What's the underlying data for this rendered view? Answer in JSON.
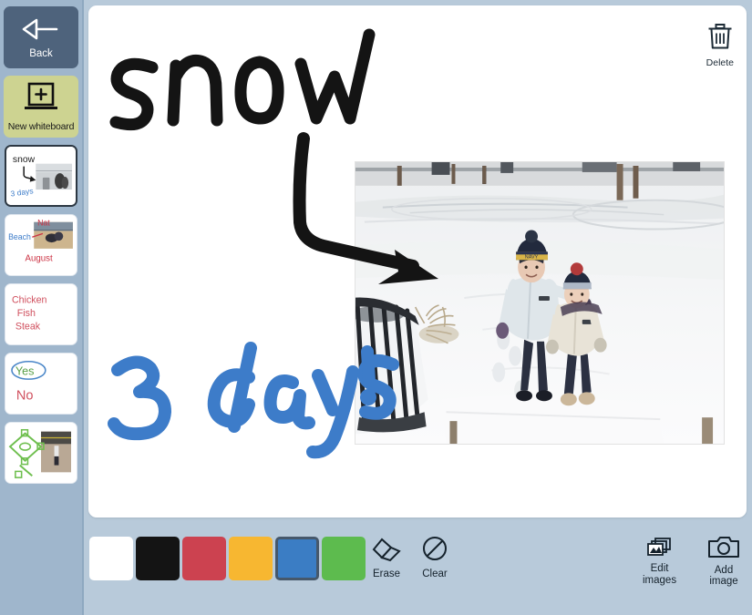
{
  "sidebar": {
    "back": {
      "label": "Back",
      "icon": "back-arrow-icon",
      "bg": "#4e637c"
    },
    "new_whiteboard": {
      "label": "New whiteboard",
      "icon": "new-whiteboard-plus-icon",
      "bg": "#cdd391"
    },
    "thumbnails": [
      {
        "name": "snow-whiteboard",
        "active": true,
        "texts": [
          "snow",
          "3 days"
        ],
        "colors": [
          "#1a1a1a",
          "#3d7cc9"
        ],
        "has_photo": true,
        "photo_subject": "two kids in snow"
      },
      {
        "name": "beach-whiteboard",
        "active": false,
        "texts": [
          "Beach",
          "Nat",
          "August"
        ],
        "colors": [
          "#3d7cc9",
          "#cc3344",
          "#cc3344"
        ],
        "has_photo": true,
        "photo_subject": "beach volleyball"
      },
      {
        "name": "menu-whiteboard",
        "active": false,
        "texts": [
          "Chicken",
          "Fish",
          "Steak"
        ],
        "colors": [
          "#d0505e"
        ],
        "has_photo": false
      },
      {
        "name": "yesno-whiteboard",
        "active": false,
        "texts": [
          "Yes",
          "No"
        ],
        "colors": [
          "#5aa04a",
          "#d0505e"
        ],
        "has_photo": false
      },
      {
        "name": "baseball-whiteboard",
        "active": false,
        "texts": [],
        "colors": [
          "#6fbf4f"
        ],
        "has_photo": true,
        "photo_subject": "child at baseball field"
      }
    ]
  },
  "canvas": {
    "delete": {
      "label": "Delete",
      "icon": "trash-icon"
    },
    "strokes": [
      {
        "text": "snow",
        "color": "#141414",
        "kind": "handwriting"
      },
      {
        "text": "3 days!",
        "color": "#3d7cc9",
        "kind": "handwriting"
      },
      {
        "text": "",
        "color": "#141414",
        "kind": "curved-arrow"
      }
    ],
    "photo": {
      "name": "snow-photo",
      "alt": "Two children in winter coats and knit hats standing in deep snow, metal railing at left"
    }
  },
  "toolbar": {
    "colors": [
      {
        "name": "white",
        "hex": "#ffffff",
        "selected": false
      },
      {
        "name": "black",
        "hex": "#141414",
        "selected": false
      },
      {
        "name": "red",
        "hex": "#cc4250",
        "selected": false
      },
      {
        "name": "yellow",
        "hex": "#f7b731",
        "selected": false
      },
      {
        "name": "blue",
        "hex": "#3b7dc4",
        "selected": true
      },
      {
        "name": "green",
        "hex": "#5dbb4e",
        "selected": false
      }
    ],
    "erase": {
      "label": "Erase",
      "icon": "eraser-icon"
    },
    "clear": {
      "label": "Clear",
      "icon": "clear-circle-slash-icon"
    },
    "edit_images": {
      "label_line1": "Edit",
      "label_line2": "images",
      "icon": "edit-images-icon"
    },
    "add_image": {
      "label": "Add image",
      "icon": "camera-icon"
    }
  }
}
